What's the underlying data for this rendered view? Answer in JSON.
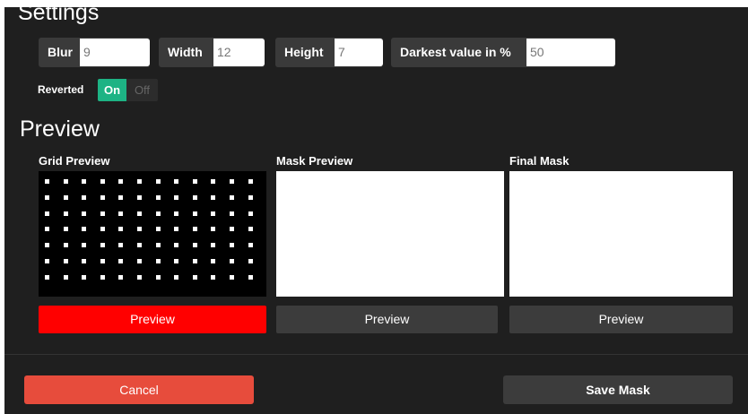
{
  "settings": {
    "title": "Settings",
    "fields": [
      {
        "label": "Blur",
        "value": "9"
      },
      {
        "label": "Width",
        "value": "12"
      },
      {
        "label": "Height",
        "value": "7"
      },
      {
        "label": "Darkest value in %",
        "value": "50"
      }
    ],
    "reverted": {
      "label": "Reverted",
      "on": "On",
      "off": "Off",
      "state": "On"
    }
  },
  "preview": {
    "title": "Preview",
    "columns": [
      {
        "label": "Grid Preview",
        "button": "Preview"
      },
      {
        "label": "Mask Preview",
        "button": "Preview"
      },
      {
        "label": "Final Mask",
        "button": "Preview"
      }
    ],
    "grid": {
      "columns": 12,
      "rows": 7
    }
  },
  "footer": {
    "cancel": "Cancel",
    "save": "Save Mask"
  },
  "colors": {
    "active_preview": "#ff0000",
    "toggle_on": "#1db384",
    "cancel": "#e74c3c"
  }
}
